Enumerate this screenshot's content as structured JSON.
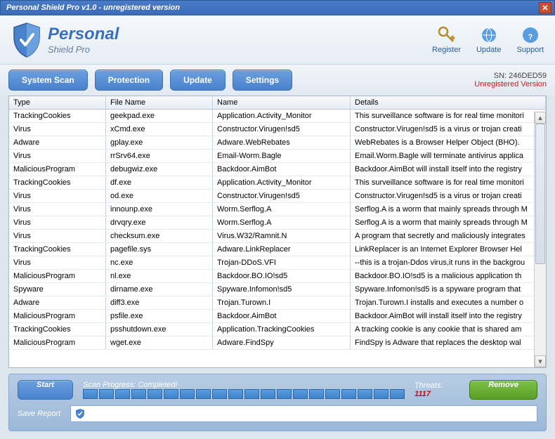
{
  "window": {
    "title": "Personal Shield Pro v1.0 - unregistered version"
  },
  "brand": {
    "big": "Personal",
    "small": "Shield Pro"
  },
  "header_links": {
    "register": "Register",
    "update": "Update",
    "support": "Support"
  },
  "nav": {
    "system_scan": "System Scan",
    "protection": "Protection",
    "update": "Update",
    "settings": "Settings"
  },
  "sn": {
    "label": "SN: 246DED59",
    "status": "Unregistered Version"
  },
  "columns": {
    "c0": "Type",
    "c1": "File Name",
    "c2": "Name",
    "c3": "Details"
  },
  "rows": [
    {
      "type": "TrackingCookies",
      "file": "geekpad.exe",
      "name": "Application.Activity_Monitor",
      "details": "This surveillance software is for real time monitori"
    },
    {
      "type": "Virus",
      "file": "xCmd.exe",
      "name": "Constructor.Virugen!sd5",
      "details": "Constructor.Virugen!sd5 is a virus or trojan creati"
    },
    {
      "type": "Adware",
      "file": "gplay.exe",
      "name": "Adware.WebRebates",
      "details": "WebRebates is a Browser Helper Object (BHO)."
    },
    {
      "type": "Virus",
      "file": "rrSrv64.exe",
      "name": "Email-Worm.Bagle",
      "details": "Email.Worm.Bagle will terminate antivirus applica"
    },
    {
      "type": "MaliciousProgram",
      "file": "debugwiz.exe",
      "name": "Backdoor.AimBot",
      "details": "Backdoor.AimBot will install itself into the registry"
    },
    {
      "type": "TrackingCookies",
      "file": "df.exe",
      "name": "Application.Activity_Monitor",
      "details": "This surveillance software is for real time monitori"
    },
    {
      "type": "Virus",
      "file": "od.exe",
      "name": "Constructor.Virugen!sd5",
      "details": "Constructor.Virugen!sd5 is a virus or trojan creati"
    },
    {
      "type": "Virus",
      "file": "innounp.exe",
      "name": "Worm.Serflog.A",
      "details": "Serflog.A is a worm that mainly spreads through M"
    },
    {
      "type": "Virus",
      "file": "drvqry.exe",
      "name": "Worm.Serflog.A",
      "details": "Serflog.A is a worm that mainly spreads through M"
    },
    {
      "type": "Virus",
      "file": "checksum.exe",
      "name": "Virus.W32/Ramnit.N",
      "details": "A program that secretly and maliciously integrates"
    },
    {
      "type": "TrackingCookies",
      "file": "pagefile.sys",
      "name": "Adware.LinkReplacer",
      "details": "LinkReplacer is an Internet Explorer Browser Hel"
    },
    {
      "type": "Virus",
      "file": "nc.exe",
      "name": "Trojan-DDoS.VFI",
      "details": "--this is a trojan-Ddos virus,it runs in the backgrou"
    },
    {
      "type": "MaliciousProgram",
      "file": "nl.exe",
      "name": "Backdoor.BO.IO!sd5",
      "details": "Backdoor.BO.IO!sd5 is a malicious application th"
    },
    {
      "type": "Spyware",
      "file": "dirname.exe",
      "name": "Spyware.Infomon!sd5",
      "details": "Spyware.Infomon!sd5 is a spyware program that"
    },
    {
      "type": "Adware",
      "file": "diff3.exe",
      "name": "Trojan.Turown.I",
      "details": "Trojan.Turown.I installs and executes a number o"
    },
    {
      "type": "MaliciousProgram",
      "file": "psfile.exe",
      "name": "Backdoor.AimBot",
      "details": "Backdoor.AimBot will install itself into the registry"
    },
    {
      "type": "TrackingCookies",
      "file": "psshutdown.exe",
      "name": "Application.TrackingCookies",
      "details": "A tracking cookie is any cookie that is shared am"
    },
    {
      "type": "MaliciousProgram",
      "file": "wget.exe",
      "name": "Adware.FindSpy",
      "details": "FindSpy is Adware that replaces the desktop wal"
    }
  ],
  "footer": {
    "start": "Start",
    "remove": "Remove",
    "save_report": "Save Report",
    "progress_label": "Scan Progress:",
    "progress_value": "Completed!",
    "threats_label": "Threats:",
    "threats_count": "1117"
  }
}
